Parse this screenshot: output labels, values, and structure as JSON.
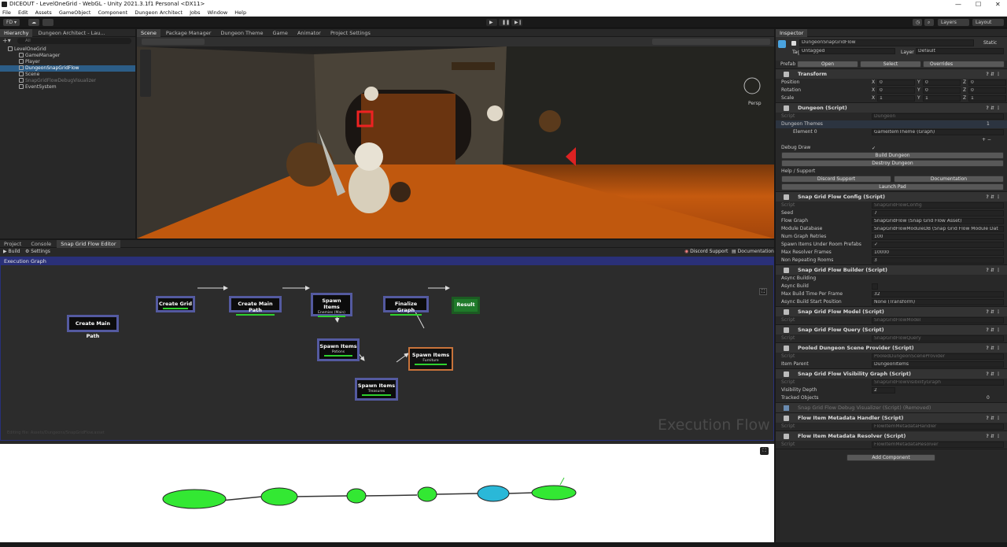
{
  "window": {
    "title": "DICEOUT - LevelOneGrid - WebGL - Unity 2021.3.1f1 Personal <DX11>",
    "minimize": "—",
    "maximize": "☐",
    "close": "✕"
  },
  "menu": [
    "File",
    "Edit",
    "Assets",
    "GameObject",
    "Component",
    "Dungeon Architect",
    "Jobs",
    "Window",
    "Help"
  ],
  "toolbar": {
    "account": "FD ▾",
    "play": "▶",
    "pause": "❚❚",
    "step": "▶❙",
    "layers": "Layers",
    "layout": "Layout",
    "history_icon": "history-icon",
    "search_icon": "search-icon"
  },
  "hierarchy": {
    "tabs": [
      "Hierarchy",
      "Dungeon Architect - Lau..."
    ],
    "search": "All",
    "items": [
      {
        "label": "LevelOneGrid",
        "indent": 0
      },
      {
        "label": "GameManager",
        "indent": 1
      },
      {
        "label": "Player",
        "indent": 1
      },
      {
        "label": "DungeonSnapGridFlow",
        "indent": 1,
        "selected": true
      },
      {
        "label": "Scene",
        "indent": 1
      },
      {
        "label": "SnapGridFlowDebugVisualizer",
        "indent": 1,
        "dim": true
      },
      {
        "label": "EventSystem",
        "indent": 1
      }
    ]
  },
  "scene": {
    "tabs": [
      "Scene",
      "Package Manager",
      "Dungeon Theme",
      "Game",
      "Animator",
      "Project Settings"
    ],
    "persp": "Persp"
  },
  "bottom": {
    "tabs": [
      "Project",
      "Console",
      "Snap Grid Flow Editor"
    ],
    "build": "Build",
    "settings": "Settings",
    "discord": "Discord Support",
    "docs": "Documentation",
    "exec_title": "Execution Graph",
    "watermark": "Execution Flow",
    "path": "Editing file: Assets/Dungeons/SnapGridFlow.asset",
    "nodes": [
      {
        "id": "n-create-main-path-1",
        "label": "Create Main Path",
        "sub": ""
      },
      {
        "id": "n-create-grid",
        "label": "Create Grid",
        "sub": ""
      },
      {
        "id": "n-create-main-path-2",
        "label": "Create Main Path",
        "sub": ""
      },
      {
        "id": "n-spawn-enemies",
        "label": "Spawn Items",
        "sub": "Enemies (Main)"
      },
      {
        "id": "n-finalize",
        "label": "Finalize Graph",
        "sub": ""
      },
      {
        "id": "n-result",
        "label": "Result",
        "sub": ""
      },
      {
        "id": "n-spawn-potions",
        "label": "Spawn Items",
        "sub": "Potions"
      },
      {
        "id": "n-spawn-furniture",
        "label": "Spawn Items",
        "sub": "Furniture"
      },
      {
        "id": "n-spawn-treasures",
        "label": "Spawn Items",
        "sub": "Treasures"
      }
    ]
  },
  "inspector": {
    "tab": "Inspector",
    "object": "DungeonSnapGridFlow",
    "static": "Static",
    "tag_label": "Tag",
    "tag": "Untagged",
    "layer_label": "Layer",
    "layer": "Default",
    "prefab": "Prefab",
    "open": "Open",
    "select": "Select",
    "overrides": "Overrides",
    "transform": {
      "title": "Transform",
      "rows": [
        [
          "Position",
          "0",
          "0",
          "0"
        ],
        [
          "Rotation",
          "0",
          "0",
          "0"
        ],
        [
          "Scale",
          "1",
          "1",
          "1"
        ]
      ]
    },
    "dungeon": {
      "title": "Dungeon (Script)",
      "script_label": "Script",
      "script": "Dungeon",
      "themes": "Dungeon Themes",
      "themes_count": "1",
      "element": "Element 0",
      "element_val": "GameItemTheme (Graph)",
      "debug": "Debug Draw",
      "build": "Build Dungeon",
      "destroy": "Destroy Dungeon",
      "help": "Help / Support",
      "discord": "Discord Support",
      "docs": "Documentation",
      "launch": "Launch Pad"
    },
    "config": {
      "title": "Snap Grid Flow Config (Script)",
      "script": "SnapGridFlowConfig",
      "rows": [
        [
          "Seed",
          "7"
        ],
        [
          "Flow Graph",
          "SnapGridFlow (Snap Grid Flow Asset)"
        ],
        [
          "Module Database",
          "SnapGridFlowModuleDB (Snap Grid Flow Module Dat"
        ],
        [
          "Num Graph Retries",
          "100"
        ],
        [
          "Spawn Items Under Room Prefabs",
          "✓"
        ],
        [
          "Max Resolver Frames",
          "10000"
        ],
        [
          "Non Repeating Rooms",
          "3"
        ]
      ]
    },
    "builder": {
      "title": "Snap Grid Flow Builder (Script)",
      "async": "Async Building",
      "async_build": "Async Build",
      "max_time": "Max Build Time Per Frame",
      "max_time_val": "32",
      "start_pos": "Async Build Start Position",
      "start_pos_val": "None (Transform)"
    },
    "model": {
      "title": "Snap Grid Flow Model (Script)",
      "script": "SnapGridFlowModel"
    },
    "query": {
      "title": "Snap Grid Flow Query (Script)",
      "script": "SnapGridFlowQuery"
    },
    "pooled": {
      "title": "Pooled Dungeon Scene Provider (Script)",
      "script": "PooledDungeonSceneProvider",
      "parent": "Item Parent",
      "parent_val": "DungeonItems"
    },
    "visibility": {
      "title": "Snap Grid Flow Visibility Graph (Script)",
      "script": "SnapGridFlowVisibilityGraph",
      "depth": "Visibility Depth",
      "depth_val": "2",
      "tracked": "Tracked Objects",
      "tracked_val": "0"
    },
    "debugvis": {
      "title": "Snap Grid Flow Debug Visualizer (Script) (Removed)"
    },
    "meta_handler": {
      "title": "Flow Item Metadata Handler (Script)",
      "script": "FlowItemMetadataHandler"
    },
    "meta_resolver": {
      "title": "Flow Item Metadata Resolver (Script)",
      "script": "FlowItemMetadataResolver"
    },
    "add": "Add Component"
  },
  "colors": {
    "accent": "#2c5d87",
    "node_border": "#545aa0",
    "green": "#2ed12e",
    "result": "#1f7a2a",
    "furniture": "#c8733a"
  }
}
